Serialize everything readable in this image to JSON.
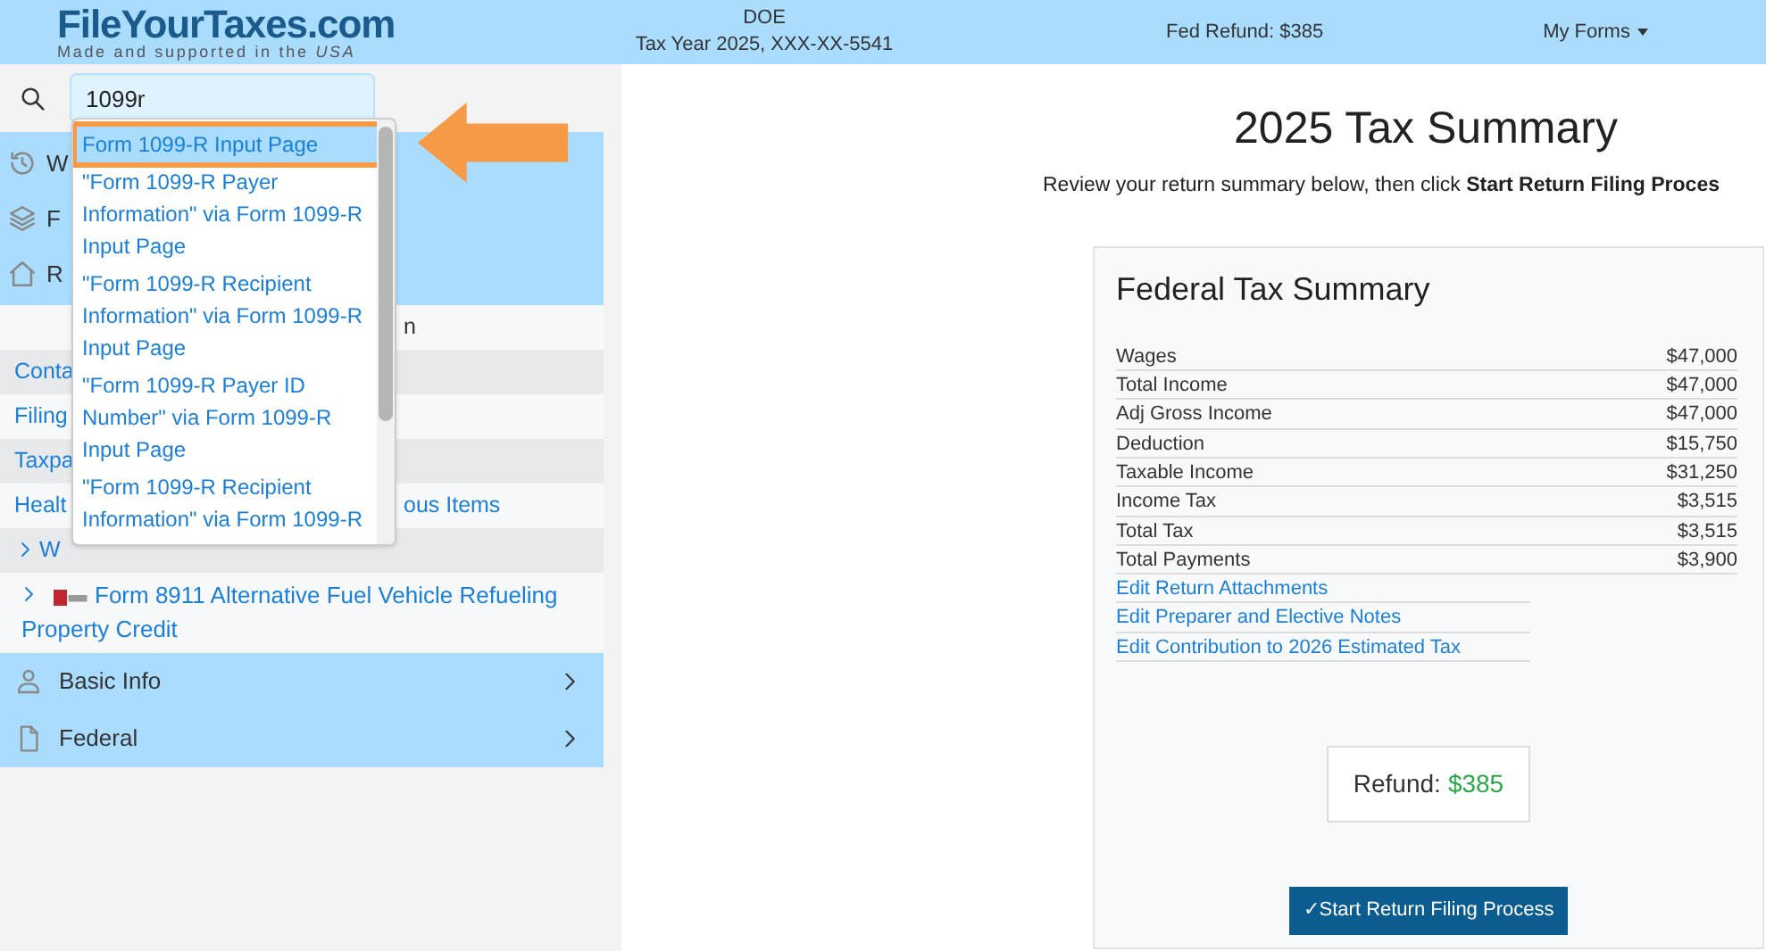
{
  "header": {
    "logo": "FileYourTaxes.com",
    "tagline": "Made and supported in the *USA*",
    "taxpayer": "DOE",
    "tax_year": "Tax Year 2025, XXX-XX-5541",
    "refund": "Fed Refund: $385",
    "menu": "My Forms"
  },
  "search": {
    "value": "1099r"
  },
  "sidebar": {
    "top_items": [
      {
        "text": "W"
      },
      {
        "text": "F"
      },
      {
        "text": "R"
      }
    ],
    "rows": [
      {
        "kind": "plain",
        "lead": "",
        "trail": "n"
      },
      {
        "kind": "link",
        "lead": "Conta",
        "trail": ""
      },
      {
        "kind": "link",
        "lead": "Filing",
        "trail": ""
      },
      {
        "kind": "link",
        "lead": "Taxpa",
        "trail": ""
      },
      {
        "kind": "link",
        "lead": "Healt",
        "trail": "ous Items"
      },
      {
        "kind": "expander",
        "lead": "W",
        "trail": ""
      },
      {
        "kind": "pdf",
        "lead": "Form 8911 Alternative Fuel Vehicle Refueling Property Credit",
        "trail": ""
      }
    ],
    "sections": [
      {
        "label": "Basic Info"
      },
      {
        "label": "Federal"
      }
    ]
  },
  "dropdown": {
    "items": [
      {
        "text": "Form 1099-R Input Page",
        "selected": true
      },
      {
        "text": "\"Form 1099-R Payer Information\" via Form 1099-R Input Page",
        "selected": false
      },
      {
        "text": "\"Form 1099-R Recipient Information\" via Form 1099-R Input Page",
        "selected": false
      },
      {
        "text": "\"Form 1099-R Payer ID Number\" via Form 1099-R Input Page",
        "selected": false
      },
      {
        "text": "\"Form 1099-R Recipient Information\" via Form 1099-R",
        "selected": false
      }
    ]
  },
  "main": {
    "title": "2025 Tax Summary",
    "subtitle": "Review your return summary below, then click **Start Return Filing Proces**",
    "card": {
      "title": "Federal Tax Summary",
      "rows": [
        {
          "label": "Wages",
          "value": "$47,000"
        },
        {
          "label": "Total Income",
          "value": "$47,000"
        },
        {
          "label": "Adj Gross Income",
          "value": "$47,000"
        },
        {
          "label": "Deduction",
          "value": "$15,750"
        },
        {
          "label": "Taxable Income",
          "value": "$31,250"
        },
        {
          "label": "Income Tax",
          "value": "$3,515"
        },
        {
          "label": "Total Tax",
          "value": "$3,515"
        },
        {
          "label": "Total Payments",
          "value": "$3,900"
        }
      ],
      "links": [
        "Edit Return Attachments",
        "Edit Preparer and Elective Notes",
        "Edit Contribution to 2026 Estimated Tax"
      ],
      "refund_label": "Refund:",
      "refund_value": "$385",
      "button": "✓Start Return Filing Process"
    }
  }
}
